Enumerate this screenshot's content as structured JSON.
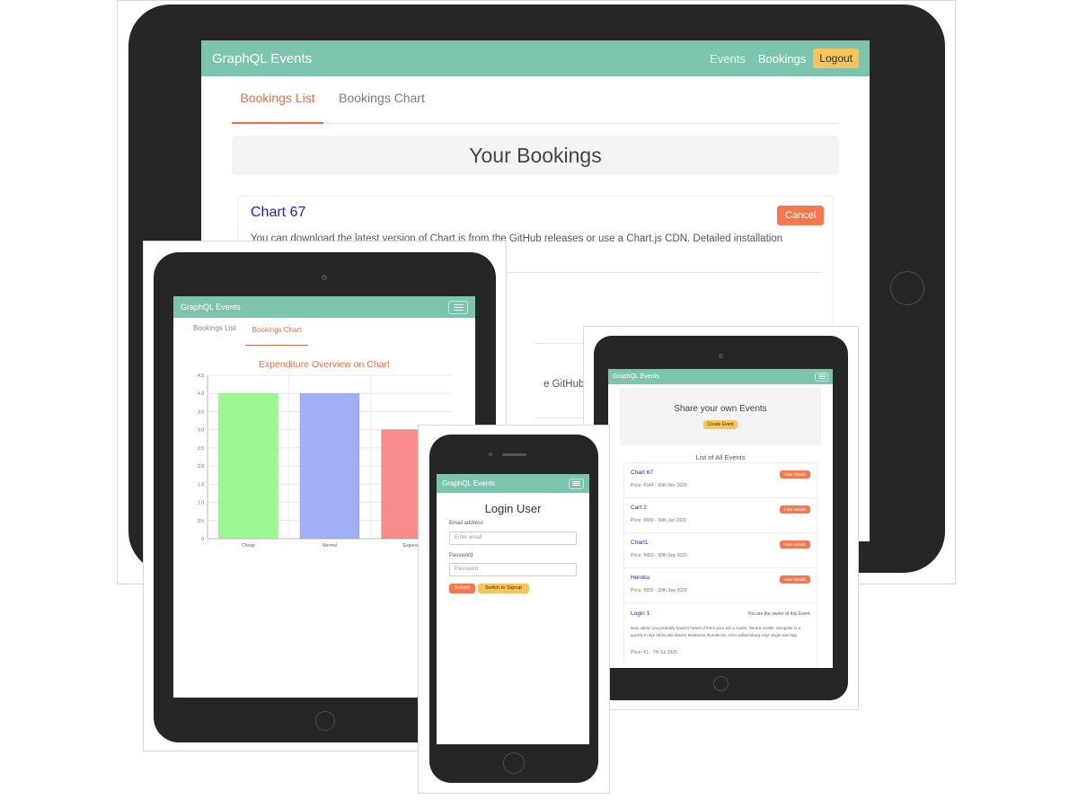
{
  "brand": "GraphQL Events",
  "colors": {
    "navbar": "#7cc4ae",
    "accent": "#f36c3f",
    "cancel": "#f6784f",
    "logout": "#f6c45a",
    "link": "#1e22cf"
  },
  "main": {
    "nav": {
      "events": "Events",
      "bookings": "Bookings",
      "logout": "Logout"
    },
    "tabs": [
      "Bookings List",
      "Bookings Chart"
    ],
    "heading": "Your Bookings",
    "booking": {
      "title": "Chart 67",
      "cancel": "Cancel",
      "desc": "You can download the latest version of Chart.js from the GitHub releases or use a Chart.js CDN. Detailed installation"
    },
    "peek_text": "e GitHub releases"
  },
  "left_tablet": {
    "tabs": [
      "Bookings List",
      "Bookings Chart"
    ],
    "chart_data": {
      "type": "bar",
      "title": "Expenditure Overview on Chart",
      "categories": [
        "Cheap",
        "Normal",
        "Expensive"
      ],
      "tick_labels": [
        "Cheap",
        "Normal",
        "Expensi"
      ],
      "values": [
        4,
        4,
        3
      ],
      "colors": [
        "#9cf98f",
        "#9fb0f6",
        "#f98b8b"
      ],
      "ylim": [
        0,
        4.5
      ],
      "yticks": [
        "0",
        "0.5",
        "1.0",
        "1.5",
        "2.0",
        "2.5",
        "3.0",
        "3.5",
        "4.0",
        "4.5"
      ]
    }
  },
  "phone": {
    "heading": "Login User",
    "email_label": "Email address",
    "email_placeholder": "Enter email",
    "password_label": "Password",
    "password_placeholder": "Password",
    "submit": "Submit",
    "switch": "Switch to Signup"
  },
  "right_tablet": {
    "hero_title": "Share your own Events",
    "hero_button": "Create Event",
    "list_title": "List of All Events",
    "view_label": "View Details",
    "events": [
      {
        "name": "Chart 67",
        "meta": "Price: ₹344 - 30th Nov 2020"
      },
      {
        "name": "Cart 2",
        "meta": "Price: ₹830 - 30th Jun 2020"
      },
      {
        "name": "Chart1",
        "meta": "Price: ₹453 - 30th Sep 2020"
      },
      {
        "name": "Heroku",
        "meta": "Price: ₹832 - 30th Sep 2020"
      }
    ],
    "owner_event": {
      "name": "Login 1",
      "owner_note": "You are the owner of this Event.",
      "desc": "Now admin you probably haven't heard of them your are a Austin, Neutra scuttle, dumpster is a quickly to dye ethnically distinct Mustache thundercat, echo williamsburg vinyl single tote bag",
      "meta": "Price: ₹1 - 7th Jul 2020"
    }
  }
}
